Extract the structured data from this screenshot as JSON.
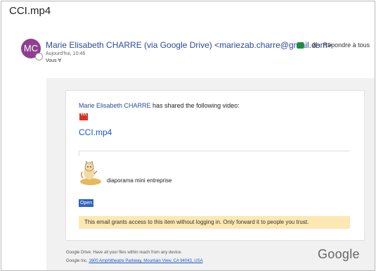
{
  "subject": "CCI.mp4",
  "sender": {
    "initials": "MC",
    "display": "Marie Elisabeth CHARRE (via Google Drive) <mariezab.charre@gmail.com>",
    "date": "Aujourd'hui, 10:46",
    "recipients": "Vous ∀"
  },
  "actions": {
    "reply_all_label": "Répondre à tous",
    "separator": "|",
    "menu_glyph": "v"
  },
  "body": {
    "sharer_name": "Marie Elisabeth CHARRE",
    "shared_text": " has shared the following video:",
    "file_name": "CCI.mp4",
    "preview_title": "diaporama mini entreprise",
    "open_label": "Open",
    "warning": "This email grants access to this item without logging in. Only forward it to people you trust."
  },
  "footer": {
    "line1": "Google Drive: Have all your files within reach from any device.",
    "company": "Google Inc. ",
    "address": "1600 Amphitheatre Parkway, Mountain View, CA 94043, USA",
    "logo_text": "Google"
  },
  "colors": {
    "avatar": "#8e3f8f",
    "link": "#1a56c4",
    "warning_bg": "#fce8b2",
    "status_green": "#1e8e3e",
    "open_button": "#2b63c6"
  },
  "icons": [
    "clapperboard-icon",
    "reply-all-icon",
    "cat-illustration-icon",
    "chevron-down-icon"
  ]
}
